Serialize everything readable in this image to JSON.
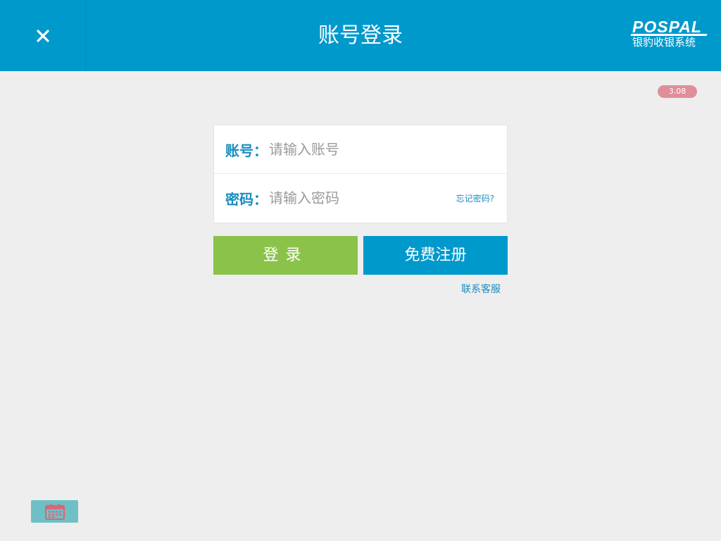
{
  "header": {
    "title": "账号登录",
    "close_icon": "close-icon"
  },
  "logo": {
    "brand": "POSPAL",
    "subtitle": "银豹收银系统"
  },
  "version": "3.08",
  "form": {
    "account_label": "账号：",
    "account_placeholder": "请输入账号",
    "password_label": "密码：",
    "password_placeholder": "请输入密码",
    "forgot_password": "忘记密码?"
  },
  "buttons": {
    "login": "登录",
    "register": "免费注册"
  },
  "contact_support": "联系客服",
  "footer": {
    "calendar_icon": "calendar-icon"
  },
  "colors": {
    "header_bg": "#0099cc",
    "login_button": "#8bc34a",
    "register_button": "#0099cc",
    "label_text": "#1a8dc0",
    "version_badge": "#df8f99",
    "calendar_button": "#6fc0c4"
  }
}
